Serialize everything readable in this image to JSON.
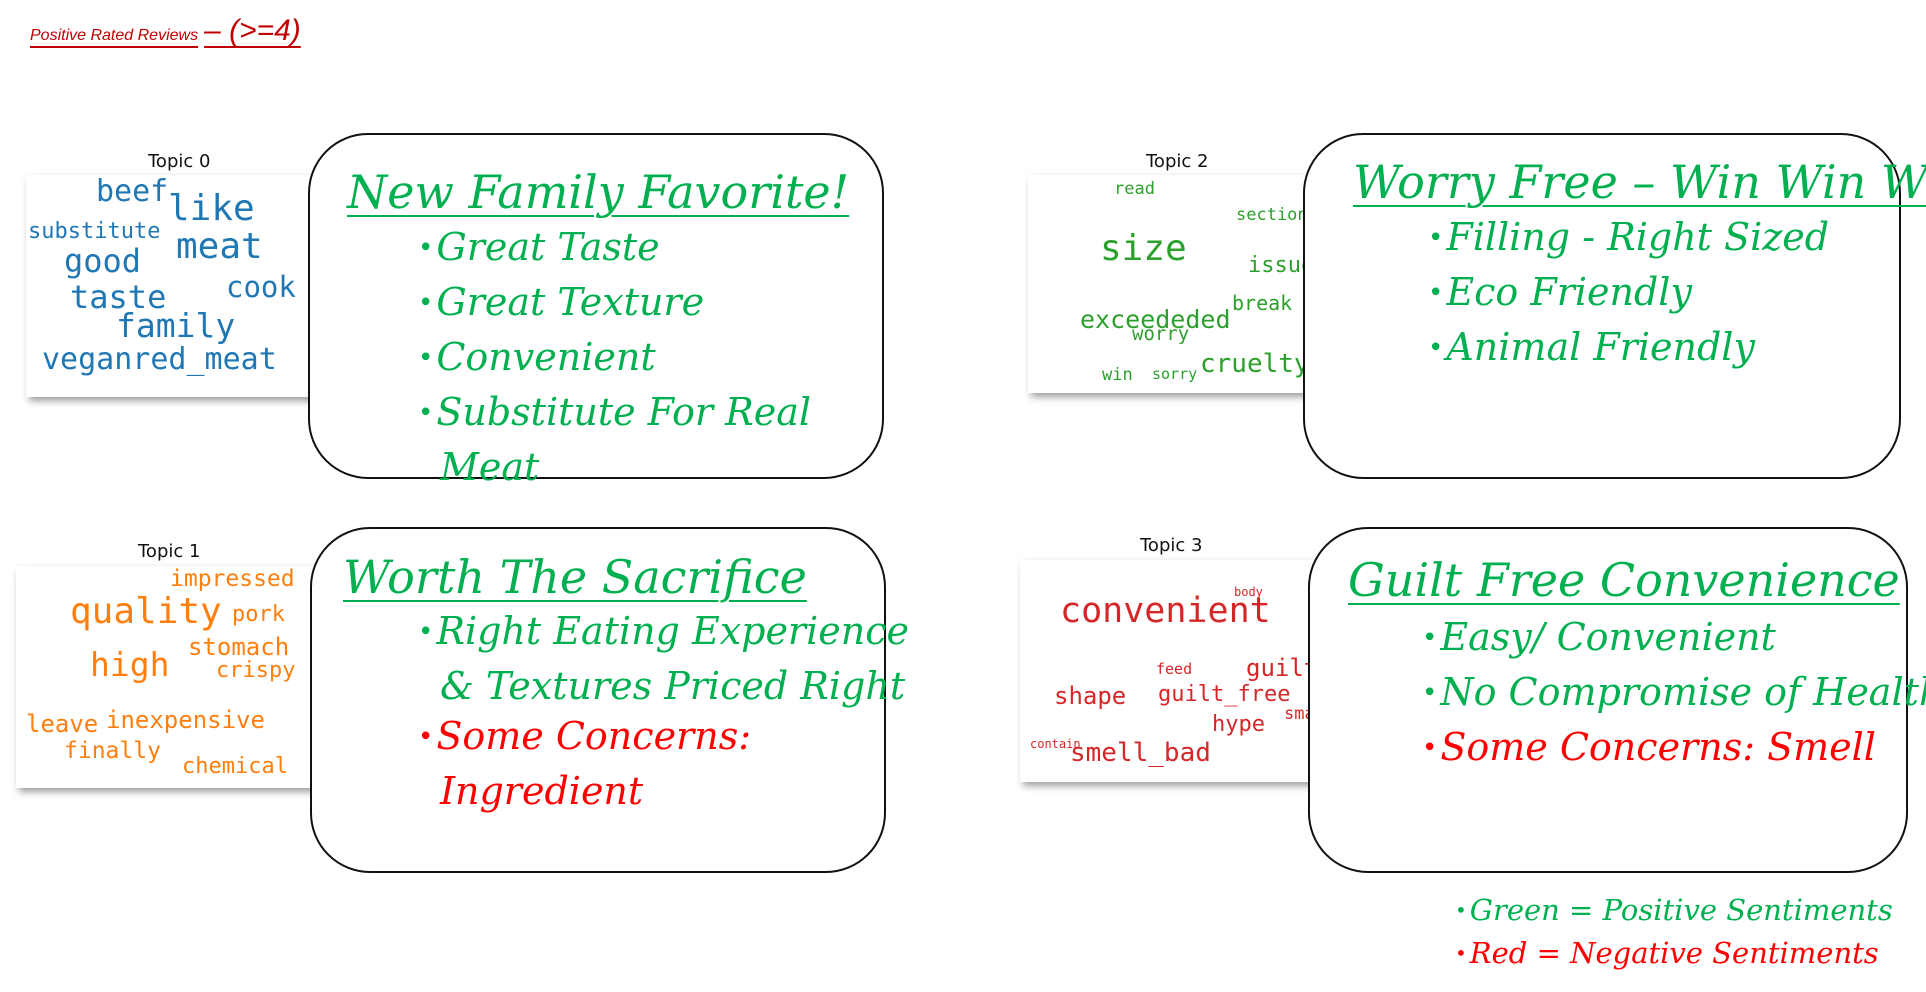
{
  "title": {
    "main": "Positive Rated Reviews",
    "sub": "– (>=4)"
  },
  "colors": {
    "title": "#c00000",
    "positive": "#00b050",
    "negative": "#ff0000",
    "topic0": "#1f77b4",
    "topic1": "#ff7f0e",
    "topic2": "#2ca02c",
    "topic3": "#d62728"
  },
  "topics": [
    {
      "label": "Topic 0",
      "words": [
        "beef",
        "like",
        "substitute",
        "meat",
        "good",
        "taste",
        "cook",
        "family",
        "veganred_meat"
      ],
      "heading": "New Family Favorite!",
      "bullets": [
        {
          "text": "Great Taste",
          "sentiment": "positive"
        },
        {
          "text": "Great Texture",
          "sentiment": "positive"
        },
        {
          "text": "Convenient",
          "sentiment": "positive"
        },
        {
          "line1": "Substitute For Real",
          "line2": "Meat",
          "sentiment": "positive"
        }
      ]
    },
    {
      "label": "Topic 1",
      "words": [
        "impressed",
        "quality",
        "pork",
        "stomach",
        "high",
        "crispy",
        "leave",
        "inexpensive",
        "finally",
        "chemical"
      ],
      "heading": "Worth The Sacrifice",
      "bullets": [
        {
          "line1": "Right Eating Experience",
          "line2": "& Textures Priced Right",
          "sentiment": "positive"
        },
        {
          "line1": "Some Concerns:",
          "line2": "Ingredient",
          "sentiment": "negative"
        }
      ]
    },
    {
      "label": "Topic 2",
      "words": [
        "read",
        "section",
        "size",
        "issue",
        "break",
        "exceededed",
        "worry",
        "cruelty",
        "win",
        "sorry"
      ],
      "heading": "Worry Free – Win Win Win",
      "bullets": [
        {
          "text": "Filling - Right Sized",
          "sentiment": "positive"
        },
        {
          "text": "Eco Friendly",
          "sentiment": "positive"
        },
        {
          "text": "Animal Friendly",
          "sentiment": "positive"
        }
      ]
    },
    {
      "label": "Topic 3",
      "words": [
        "body",
        "convenient",
        "feed",
        "guilt",
        "shape",
        "guilt_free",
        "small",
        "hype",
        "contain",
        "smell_bad"
      ],
      "heading": "Guilt Free Convenience",
      "bullets": [
        {
          "text": "Easy/ Convenient",
          "sentiment": "positive"
        },
        {
          "text": "No Compromise of Health",
          "sentiment": "positive"
        },
        {
          "text": "Some Concerns: Smell",
          "sentiment": "negative"
        }
      ]
    }
  ],
  "legend": [
    {
      "text": "Green = Positive Sentiments",
      "sentiment": "positive"
    },
    {
      "text": "Red = Negative Sentiments",
      "sentiment": "negative"
    }
  ]
}
